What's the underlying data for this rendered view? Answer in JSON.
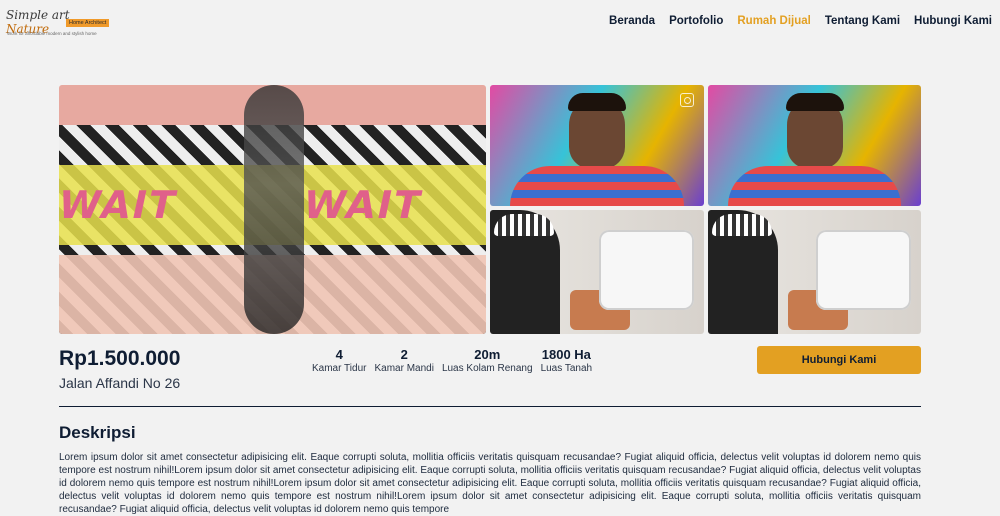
{
  "logo": {
    "line1_a": "Simple art",
    "line1_b": "Nature",
    "tag": "Home Architect",
    "subtitle": "Work for affordable modern and stylish home"
  },
  "nav": {
    "items": [
      {
        "label": "Beranda"
      },
      {
        "label": "Portofolio"
      },
      {
        "label": "Rumah Dijual",
        "active": true
      },
      {
        "label": "Tentang Kami"
      },
      {
        "label": "Hubungi Kami"
      }
    ]
  },
  "gallery": {
    "main_text": "WAIT"
  },
  "listing": {
    "price": "Rp1.500.000",
    "address": "Jalan Affandi No 26",
    "stats": [
      {
        "value": "4",
        "label": "Kamar Tidur"
      },
      {
        "value": "2",
        "label": "Kamar Mandi"
      },
      {
        "value": "20m",
        "label": "Luas Kolam Renang"
      },
      {
        "value": "1800 Ha",
        "label": "Luas Tanah"
      }
    ],
    "cta_label": "Hubungi Kami"
  },
  "description": {
    "title": "Deskripsi",
    "text": "Lorem ipsum dolor sit amet consectetur adipisicing elit. Eaque corrupti soluta, mollitia officiis veritatis quisquam recusandae? Fugiat aliquid officia, delectus velit voluptas id dolorem nemo quis tempore est nostrum nihil!Lorem ipsum dolor sit amet consectetur adipisicing elit. Eaque corrupti soluta, mollitia officiis veritatis quisquam recusandae? Fugiat aliquid officia, delectus velit voluptas id dolorem nemo quis tempore est nostrum nihil!Lorem ipsum dolor sit amet consectetur adipisicing elit. Eaque corrupti soluta, mollitia officiis veritatis quisquam recusandae? Fugiat aliquid officia, delectus velit voluptas id dolorem nemo quis tempore est nostrum nihil!Lorem ipsum dolor sit amet consectetur adipisicing elit. Eaque corrupti soluta, mollitia officiis veritatis quisquam recusandae? Fugiat aliquid officia, delectus velit voluptas id dolorem nemo quis tempore"
  },
  "colors": {
    "accent": "#e3a022",
    "navy": "#0f1d33",
    "background": "#f2f2f2"
  },
  "icons": {
    "zoom": "zoom-icon"
  }
}
